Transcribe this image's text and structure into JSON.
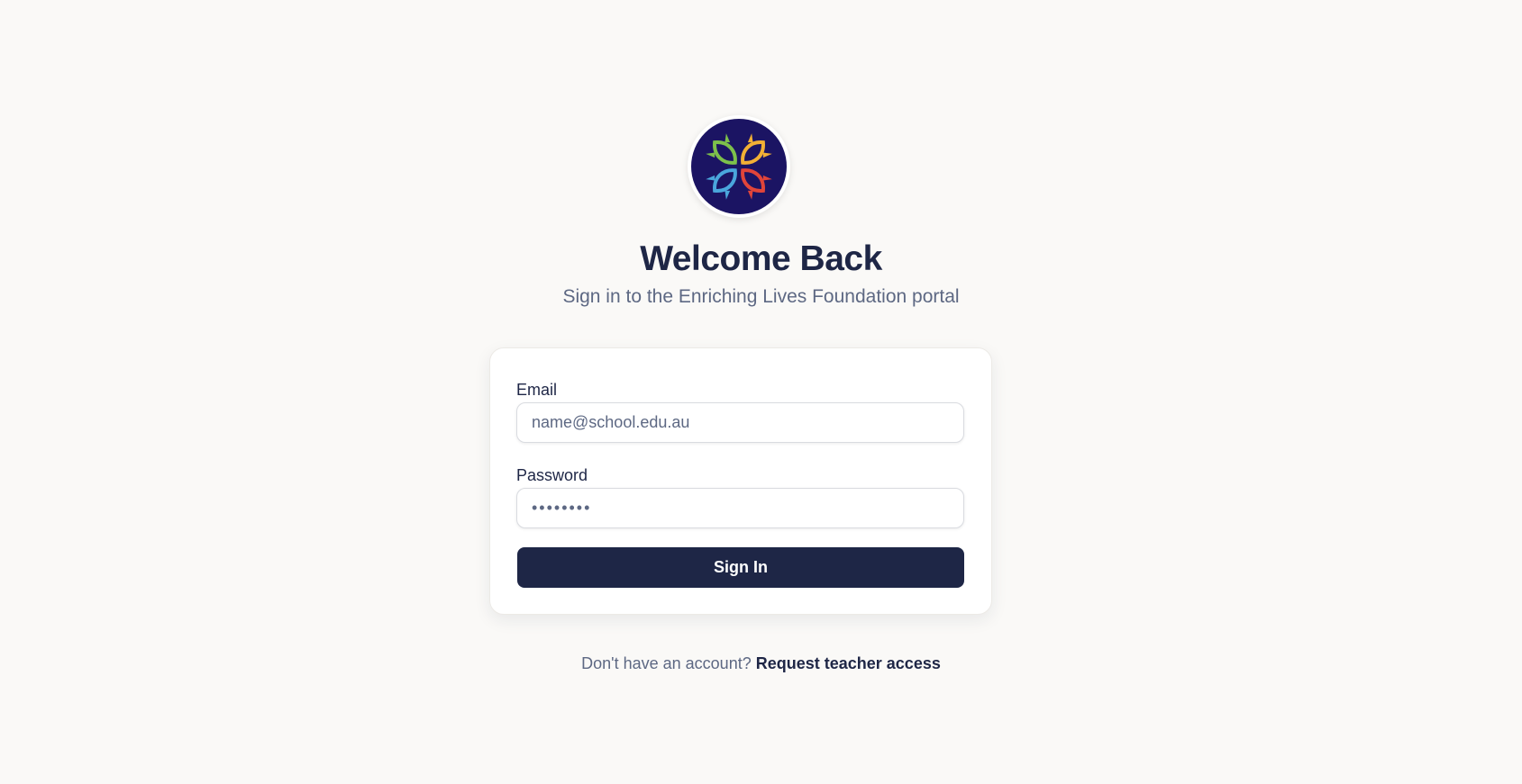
{
  "brand": {
    "logo_icon": "flower-logo-icon",
    "logo_background": "#1b1463",
    "petal_colors": [
      "#7dc04b",
      "#f2b035",
      "#4aa6dc",
      "#e0453a"
    ]
  },
  "header": {
    "title": "Welcome Back",
    "subtitle": "Sign in to the Enriching Lives Foundation portal"
  },
  "form": {
    "email_label": "Email",
    "email_placeholder": "name@school.edu.au",
    "email_value": "",
    "password_label": "Password",
    "password_value": "••••••••",
    "submit_label": "Sign In"
  },
  "footer": {
    "prompt": "Don't have an account?",
    "link_label": "Request teacher access"
  },
  "colors": {
    "page_background": "#faf9f7",
    "primary": "#1e2646",
    "muted_text": "#5d6883"
  }
}
